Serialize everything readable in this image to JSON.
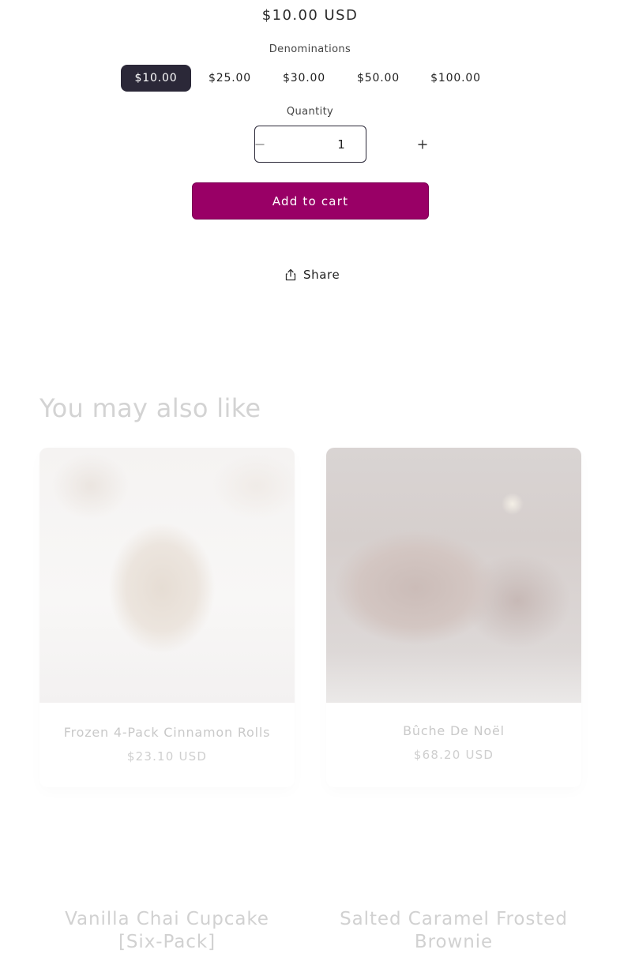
{
  "product": {
    "price": "$10.00 USD",
    "denominations_label": "Denominations",
    "denominations": [
      "$10.00",
      "$25.00",
      "$30.00",
      "$50.00",
      "$100.00"
    ],
    "selected_denomination": "$10.00",
    "quantity_label": "Quantity",
    "quantity_value": "1",
    "decrease_icon": "minus-icon",
    "increase_icon": "plus-icon",
    "add_to_cart_label": "Add to cart",
    "share_label": "Share",
    "share_icon": "share-icon"
  },
  "recommendations": {
    "title": "You may also like",
    "items": [
      {
        "name": "Frozen 4-Pack Cinnamon Rolls",
        "price": "$23.10 USD"
      },
      {
        "name": "Bûche De Noël",
        "price": "$68.20 USD"
      },
      {
        "name": "Vanilla Chai Cupcake [Six-Pack]"
      },
      {
        "name": "Salted Caramel Frosted Brownie"
      }
    ]
  },
  "colors": {
    "accent": "#990066",
    "selected_pill": "#2b2838"
  }
}
